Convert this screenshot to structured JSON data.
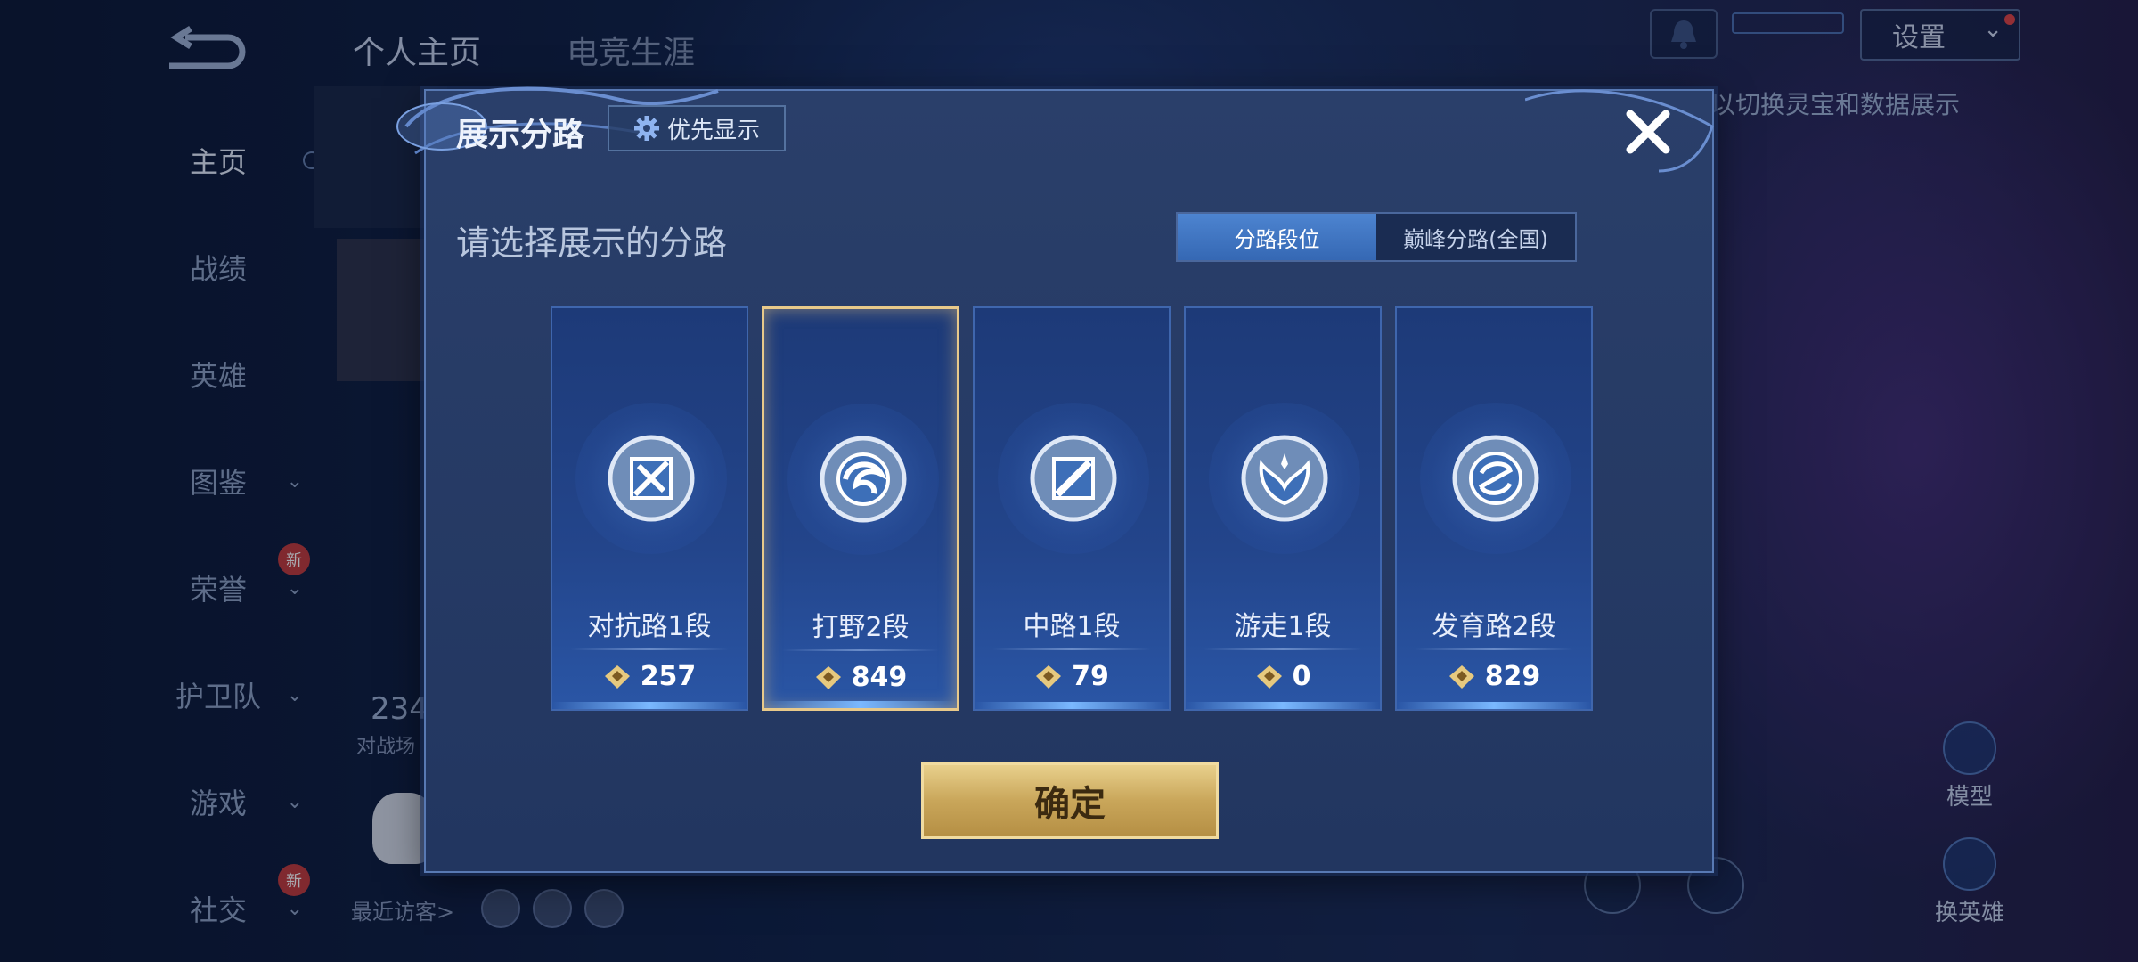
{
  "sidebar": {
    "items": [
      {
        "label": "主页",
        "active": true
      },
      {
        "label": "战绩"
      },
      {
        "label": "英雄"
      },
      {
        "label": "图鉴",
        "chevron": true
      },
      {
        "label": "荣誉",
        "chevron": true,
        "badge": "新"
      },
      {
        "label": "护卫队",
        "chevron": true
      },
      {
        "label": "游戏",
        "chevron": true
      },
      {
        "label": "社交",
        "chevron": true,
        "badge": "新"
      }
    ]
  },
  "header": {
    "tabs": [
      "个人主页",
      "电竞生涯"
    ],
    "settings_label": "设置",
    "hint_text": "以切换灵宝和数据展示"
  },
  "background": {
    "stat_number": "234",
    "stat_label": "对战场",
    "visitors_label": "最近访客>",
    "right_icons": [
      "模型",
      "换英雄"
    ]
  },
  "modal": {
    "title": "展示分路",
    "priority_label": "优先显示",
    "prompt": "请选择展示的分路",
    "segment": {
      "options": [
        "分路段位",
        "巅峰分路(全国)"
      ],
      "active_index": 0
    },
    "lanes": [
      {
        "label": "对抗路1段",
        "score": "257",
        "icon": "sword-shield-icon",
        "selected": false
      },
      {
        "label": "打野2段",
        "score": "849",
        "icon": "dragon-claw-icon",
        "selected": true
      },
      {
        "label": "中路1段",
        "score": "79",
        "icon": "staff-icon",
        "selected": false
      },
      {
        "label": "游走1段",
        "score": "0",
        "icon": "wings-icon",
        "selected": false
      },
      {
        "label": "发育路2段",
        "score": "829",
        "icon": "bow-icon",
        "selected": false
      }
    ],
    "confirm_label": "确定"
  },
  "colors": {
    "accent_gold": "#e8c98a",
    "panel_bg": "#2a3f6a",
    "segment_active": "#3f76c4"
  }
}
